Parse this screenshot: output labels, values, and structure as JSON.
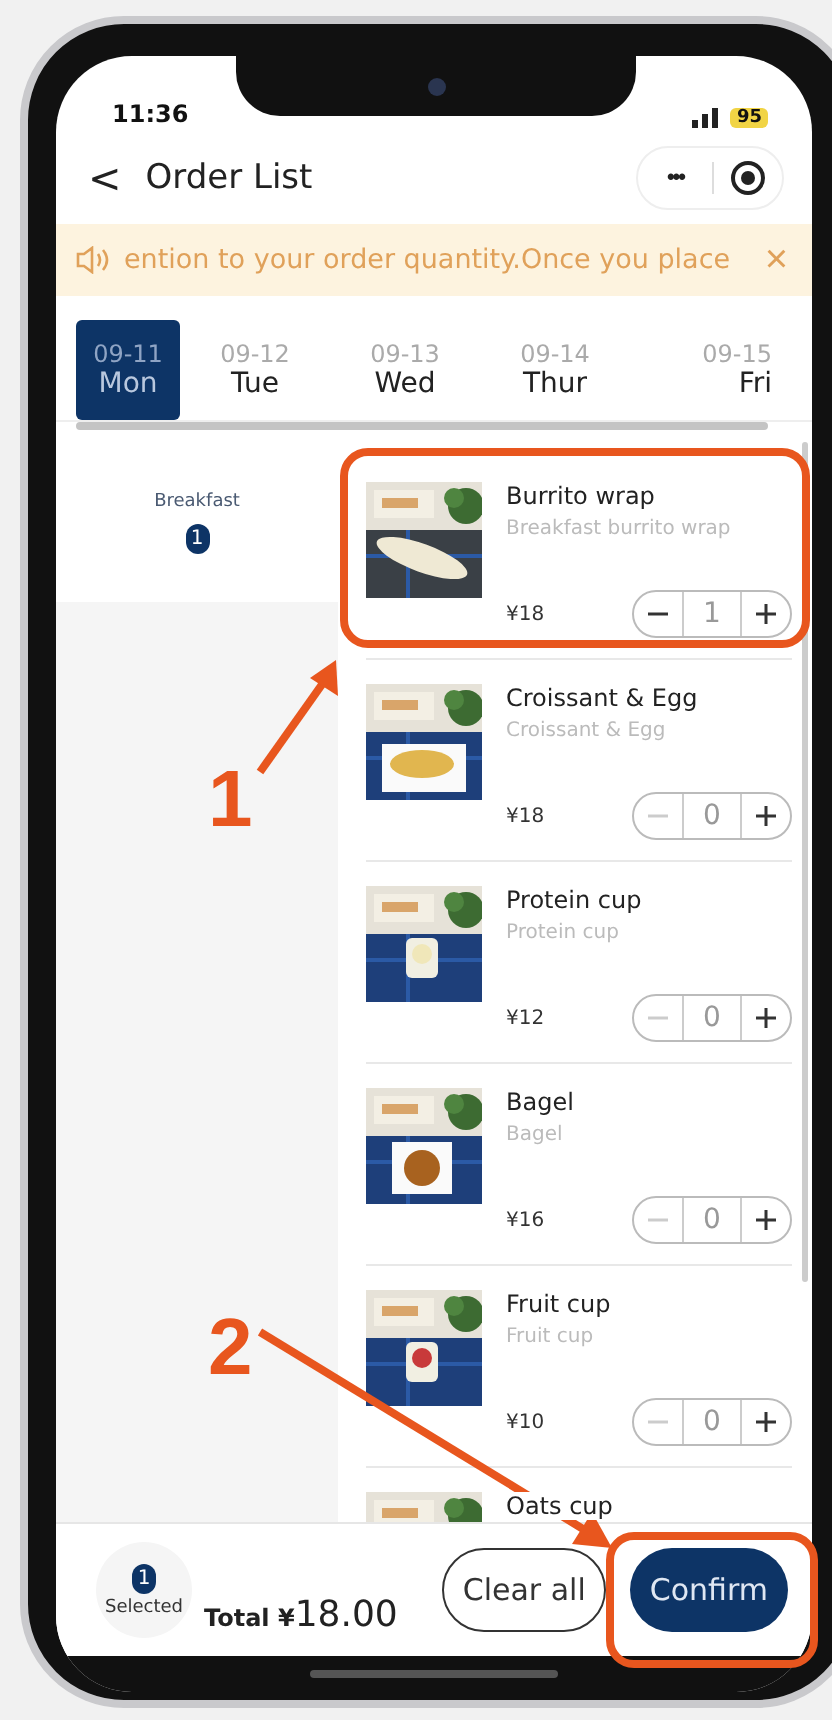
{
  "status_bar": {
    "time": "11:36",
    "battery": "95"
  },
  "nav": {
    "back": "<",
    "title": "Order List",
    "more": "•••"
  },
  "notice": {
    "text": "ention to your order quantity.Once you place",
    "close": "×"
  },
  "date_tabs": [
    {
      "date": "09-11",
      "day": "Mon",
      "selected": true
    },
    {
      "date": "09-12",
      "day": "Tue",
      "selected": false
    },
    {
      "date": "09-13",
      "day": "Wed",
      "selected": false
    },
    {
      "date": "09-14",
      "day": "Thur",
      "selected": false
    },
    {
      "date": "09-15",
      "day": "Fri",
      "selected": false
    }
  ],
  "categories": [
    {
      "label": "Breakfast",
      "count": "1",
      "selected": true
    }
  ],
  "items": [
    {
      "name": "Burrito wrap",
      "description": "Breakfast burrito wrap",
      "price": "¥18",
      "quantity": "1",
      "minus_disabled": false
    },
    {
      "name": "Croissant & Egg",
      "description": "Croissant & Egg",
      "price": "¥18",
      "quantity": "0",
      "minus_disabled": true
    },
    {
      "name": "Protein cup",
      "description": "Protein cup",
      "price": "¥12",
      "quantity": "0",
      "minus_disabled": true
    },
    {
      "name": "Bagel",
      "description": "Bagel",
      "price": "¥16",
      "quantity": "0",
      "minus_disabled": true
    },
    {
      "name": "Fruit cup",
      "description": "Fruit cup",
      "price": "¥10",
      "quantity": "0",
      "minus_disabled": true
    },
    {
      "name": "Oats cup"
    }
  ],
  "footer": {
    "selected_count": "1",
    "selected_label": "Selected",
    "total_label": "Total",
    "total_currency": "¥",
    "total_value": "18.00",
    "clear_button": "Clear all",
    "confirm_button": "Confirm"
  },
  "annotations": [
    {
      "number": "1"
    },
    {
      "number": "2"
    }
  ]
}
